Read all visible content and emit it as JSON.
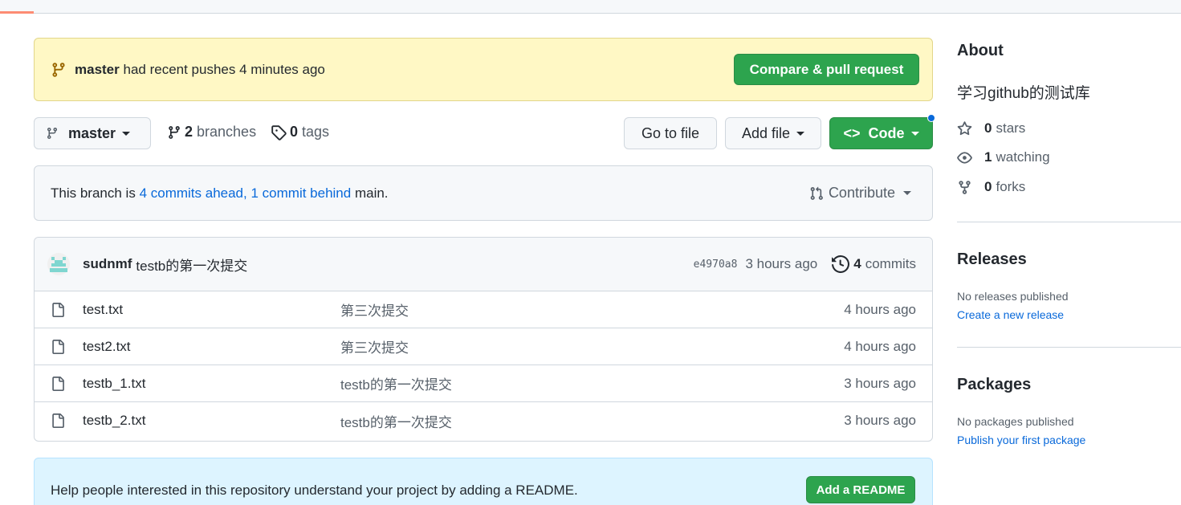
{
  "banner": {
    "branch": "master",
    "message": "had recent pushes 4 minutes ago",
    "compare_label": "Compare & pull request"
  },
  "branch_row": {
    "current_branch": "master",
    "branches_count": "2",
    "branches_label": "branches",
    "tags_count": "0",
    "tags_label": "tags",
    "goto_label": "Go to file",
    "addfile_label": "Add file",
    "code_label": "Code"
  },
  "ahead_behind": {
    "prefix": "This branch is",
    "ahead_link": "4 commits ahead,",
    "behind_link": "1 commit behind",
    "suffix": "main.",
    "contribute_label": "Contribute"
  },
  "latest_commit": {
    "author": "sudnmf",
    "message": "testb的第一次提交",
    "sha": "e4970a8",
    "time": "3 hours ago",
    "commits_count": "4",
    "commits_label": "commits"
  },
  "files": [
    {
      "name": "test.txt",
      "message": "第三次提交",
      "time": "4 hours ago"
    },
    {
      "name": "test2.txt",
      "message": "第三次提交",
      "time": "4 hours ago"
    },
    {
      "name": "testb_1.txt",
      "message": "testb的第一次提交",
      "time": "3 hours ago"
    },
    {
      "name": "testb_2.txt",
      "message": "testb的第一次提交",
      "time": "3 hours ago"
    }
  ],
  "readme": {
    "text": "Help people interested in this repository understand your project by adding a README.",
    "button_label": "Add a README"
  },
  "sidebar": {
    "about_title": "About",
    "description": "学习github的测试库",
    "stars_count": "0",
    "stars_label": "stars",
    "watching_count": "1",
    "watching_label": "watching",
    "forks_count": "0",
    "forks_label": "forks",
    "releases_title": "Releases",
    "releases_empty": "No releases published",
    "releases_link": "Create a new release",
    "packages_title": "Packages",
    "packages_empty": "No packages published",
    "packages_link": "Publish your first package"
  },
  "colors": {
    "primary_green": "#2da44e",
    "link_blue": "#0969da",
    "banner_yellow": "#fff8c5",
    "readme_blue": "#ddf4ff",
    "tab_underline": "#fd8c73"
  }
}
